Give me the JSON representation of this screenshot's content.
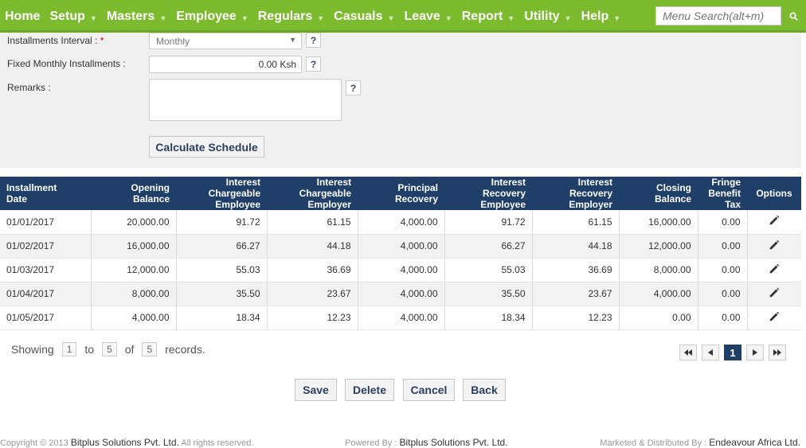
{
  "nav": {
    "items": [
      "Home",
      "Setup",
      "Masters",
      "Employee",
      "Regulars",
      "Casuals",
      "Leave",
      "Report",
      "Utility",
      "Help"
    ],
    "search_placeholder": "Menu Search(alt+m)"
  },
  "form": {
    "interval_label": "Installments Interval :",
    "required_mark": "*",
    "interval_value": "Monthly",
    "fixed_label": "Fixed Monthly Installments :",
    "fixed_value": "0.00 Ksh",
    "remarks_label": "Remarks :",
    "help_mark": "?",
    "calculate_label": "Calculate Schedule"
  },
  "table": {
    "headers": [
      [
        "Installment",
        "Date"
      ],
      [
        "Opening",
        "Balance"
      ],
      [
        "Interest",
        "Chargeable",
        "Employee"
      ],
      [
        "Interest",
        "Chargeable",
        "Employer"
      ],
      [
        "Principal",
        "Recovery"
      ],
      [
        "Interest",
        "Recovery",
        "Employee"
      ],
      [
        "Interest",
        "Recovery",
        "Employer"
      ],
      [
        "Closing",
        "Balance"
      ],
      [
        "Fringe",
        "Benefit",
        "Tax"
      ],
      [
        "Options"
      ]
    ],
    "rows": [
      [
        "01/01/2017",
        "20,000.00",
        "91.72",
        "61.15",
        "4,000.00",
        "91.72",
        "61.15",
        "16,000.00",
        "0.00"
      ],
      [
        "01/02/2017",
        "16,000.00",
        "66.27",
        "44.18",
        "4,000.00",
        "66.27",
        "44.18",
        "12,000.00",
        "0.00"
      ],
      [
        "01/03/2017",
        "12,000.00",
        "55.03",
        "36.69",
        "4,000.00",
        "55.03",
        "36.69",
        "8,000.00",
        "0.00"
      ],
      [
        "01/04/2017",
        "8,000.00",
        "35.50",
        "23.67",
        "4,000.00",
        "35.50",
        "23.67",
        "4,000.00",
        "0.00"
      ],
      [
        "01/05/2017",
        "4,000.00",
        "18.34",
        "12.23",
        "4,000.00",
        "18.34",
        "12.23",
        "0.00",
        "0.00"
      ]
    ],
    "row_icon": "pencil-icon"
  },
  "paging": {
    "showing": "Showing",
    "from": "1",
    "to_label": "to",
    "to": "5",
    "of_label": "of",
    "total": "5",
    "records": "records.",
    "current_page": "1"
  },
  "actions": {
    "save": "Save",
    "delete": "Delete",
    "cancel": "Cancel",
    "back": "Back"
  },
  "footer": {
    "copyright_prefix": "Copyright © 2013",
    "copyright_company": "Bitplus Solutions Pvt. Ltd.",
    "rights": "All rights reserved.",
    "powered_label": "Powered By :",
    "powered_company": "Bitplus Solutions Pvt. Ltd.",
    "marketed_label": "Marketed & Distributed By :",
    "marketed_company": "Endeavour Africa Ltd."
  },
  "colors": {
    "nav_green": "#7cbb2e",
    "header_navy": "#1f3e68"
  }
}
